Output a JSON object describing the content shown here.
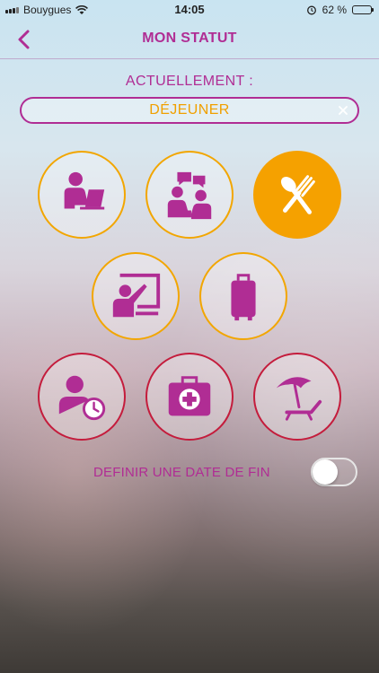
{
  "statusbar": {
    "carrier": "Bouygues",
    "time": "14:05",
    "battery": "62 %",
    "battery_level": 0.62
  },
  "header": {
    "title": "MON STATUT"
  },
  "current": {
    "label": "ACTUELLEMENT :",
    "value": "DÉJEUNER"
  },
  "statuses": [
    {
      "id": "work-at-desk",
      "icon": "person-laptop-icon",
      "active": false
    },
    {
      "id": "meeting",
      "icon": "meeting-icon",
      "active": false
    },
    {
      "id": "lunch",
      "icon": "fork-spoon-icon",
      "active": true
    },
    {
      "id": "training",
      "icon": "presentation-icon",
      "active": false
    },
    {
      "id": "travel",
      "icon": "suitcase-icon",
      "active": false
    },
    {
      "id": "absent",
      "icon": "person-clock-icon",
      "active": false
    },
    {
      "id": "sick",
      "icon": "medical-kit-icon",
      "active": false
    },
    {
      "id": "vacation",
      "icon": "beach-umbrella-icon",
      "active": false
    }
  ],
  "end_date": {
    "label": "DEFINIR UNE DATE DE FIN",
    "enabled": false
  },
  "colors": {
    "accent": "#b02d94",
    "orange": "#f5a100",
    "red": "#c41c3c",
    "value_text": "#f0a000"
  }
}
